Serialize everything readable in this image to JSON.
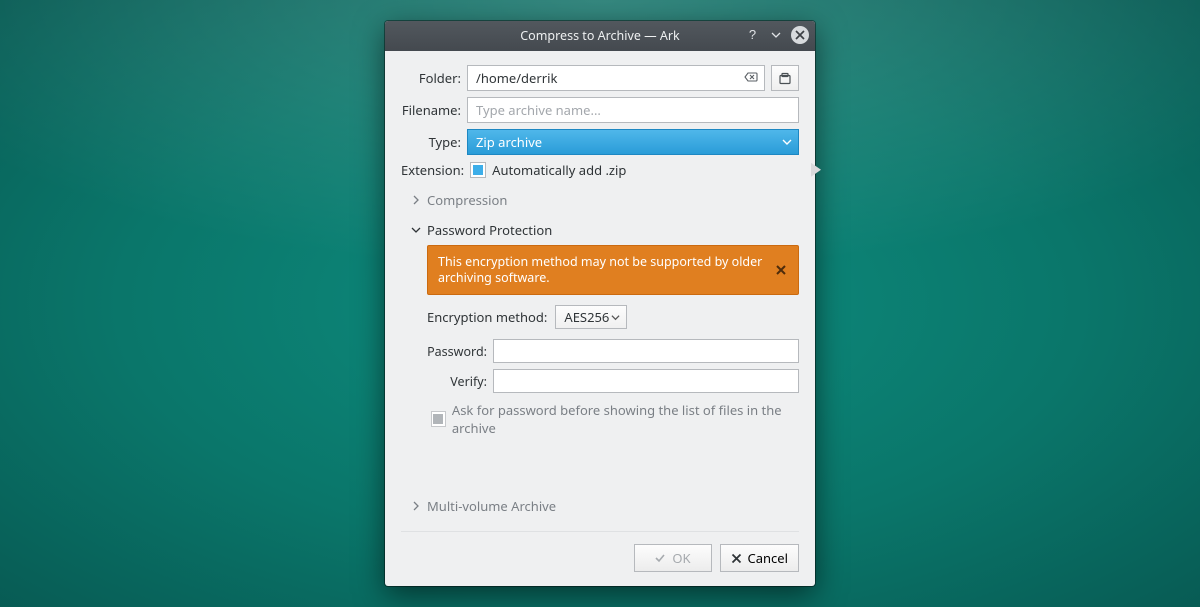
{
  "window": {
    "title": "Compress to Archive — Ark"
  },
  "form": {
    "folder_label": "Folder:",
    "folder_value": "/home/derrik",
    "filename_label": "Filename:",
    "filename_placeholder": "Type archive name...",
    "filename_value": "",
    "type_label": "Type:",
    "type_value": "Zip archive",
    "extension_label": "Extension:",
    "extension_checkbox_text": "Automatically add .zip",
    "extension_checked": true
  },
  "sections": {
    "compression": "Compression",
    "password_protection": "Password Protection",
    "multi_volume": "Multi-volume Archive"
  },
  "password": {
    "warning_text": "This encryption method may not be supported by older archiving software.",
    "encryption_method_label": "Encryption method:",
    "encryption_method_value": "AES256",
    "password_label": "Password:",
    "password_value": "",
    "verify_label": "Verify:",
    "verify_value": "",
    "ask_label": "Ask for password before showing the list of files in the archive",
    "ask_checked": false
  },
  "buttons": {
    "ok": "OK",
    "cancel": "Cancel"
  }
}
